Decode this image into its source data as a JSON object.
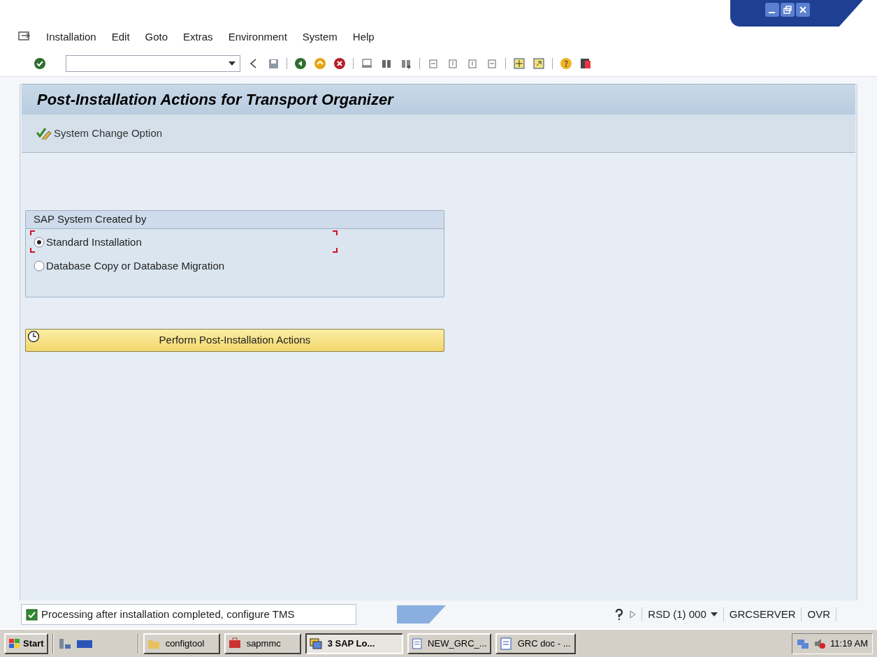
{
  "menu_bar": {
    "items": [
      "Installation",
      "Edit",
      "Goto",
      "Extras",
      "Environment",
      "System",
      "Help"
    ]
  },
  "screen": {
    "title": "Post-Installation Actions for Transport Organizer",
    "actions": [
      "System Change Option"
    ],
    "group": {
      "title": "SAP System Created by",
      "options": [
        {
          "label": "Standard Installation",
          "selected": true
        },
        {
          "label": "Database Copy or Database Migration",
          "selected": false
        }
      ]
    },
    "perform_button": "Perform Post-Installation Actions"
  },
  "status_bar": {
    "message": "Processing after installation completed, configure TMS",
    "success": true,
    "system": "RSD (1) 000",
    "server": "GRCSERVER",
    "mode": "OVR"
  },
  "taskbar": {
    "start": "Start",
    "tasks": [
      {
        "label": "configtool",
        "selected": false
      },
      {
        "label": "sapmmc",
        "selected": false
      },
      {
        "label": "3 SAP Lo...",
        "selected": true
      },
      {
        "label": "NEW_GRC_...",
        "selected": false
      },
      {
        "label": "GRC doc - ...",
        "selected": false
      }
    ],
    "clock": "11:19 AM"
  }
}
